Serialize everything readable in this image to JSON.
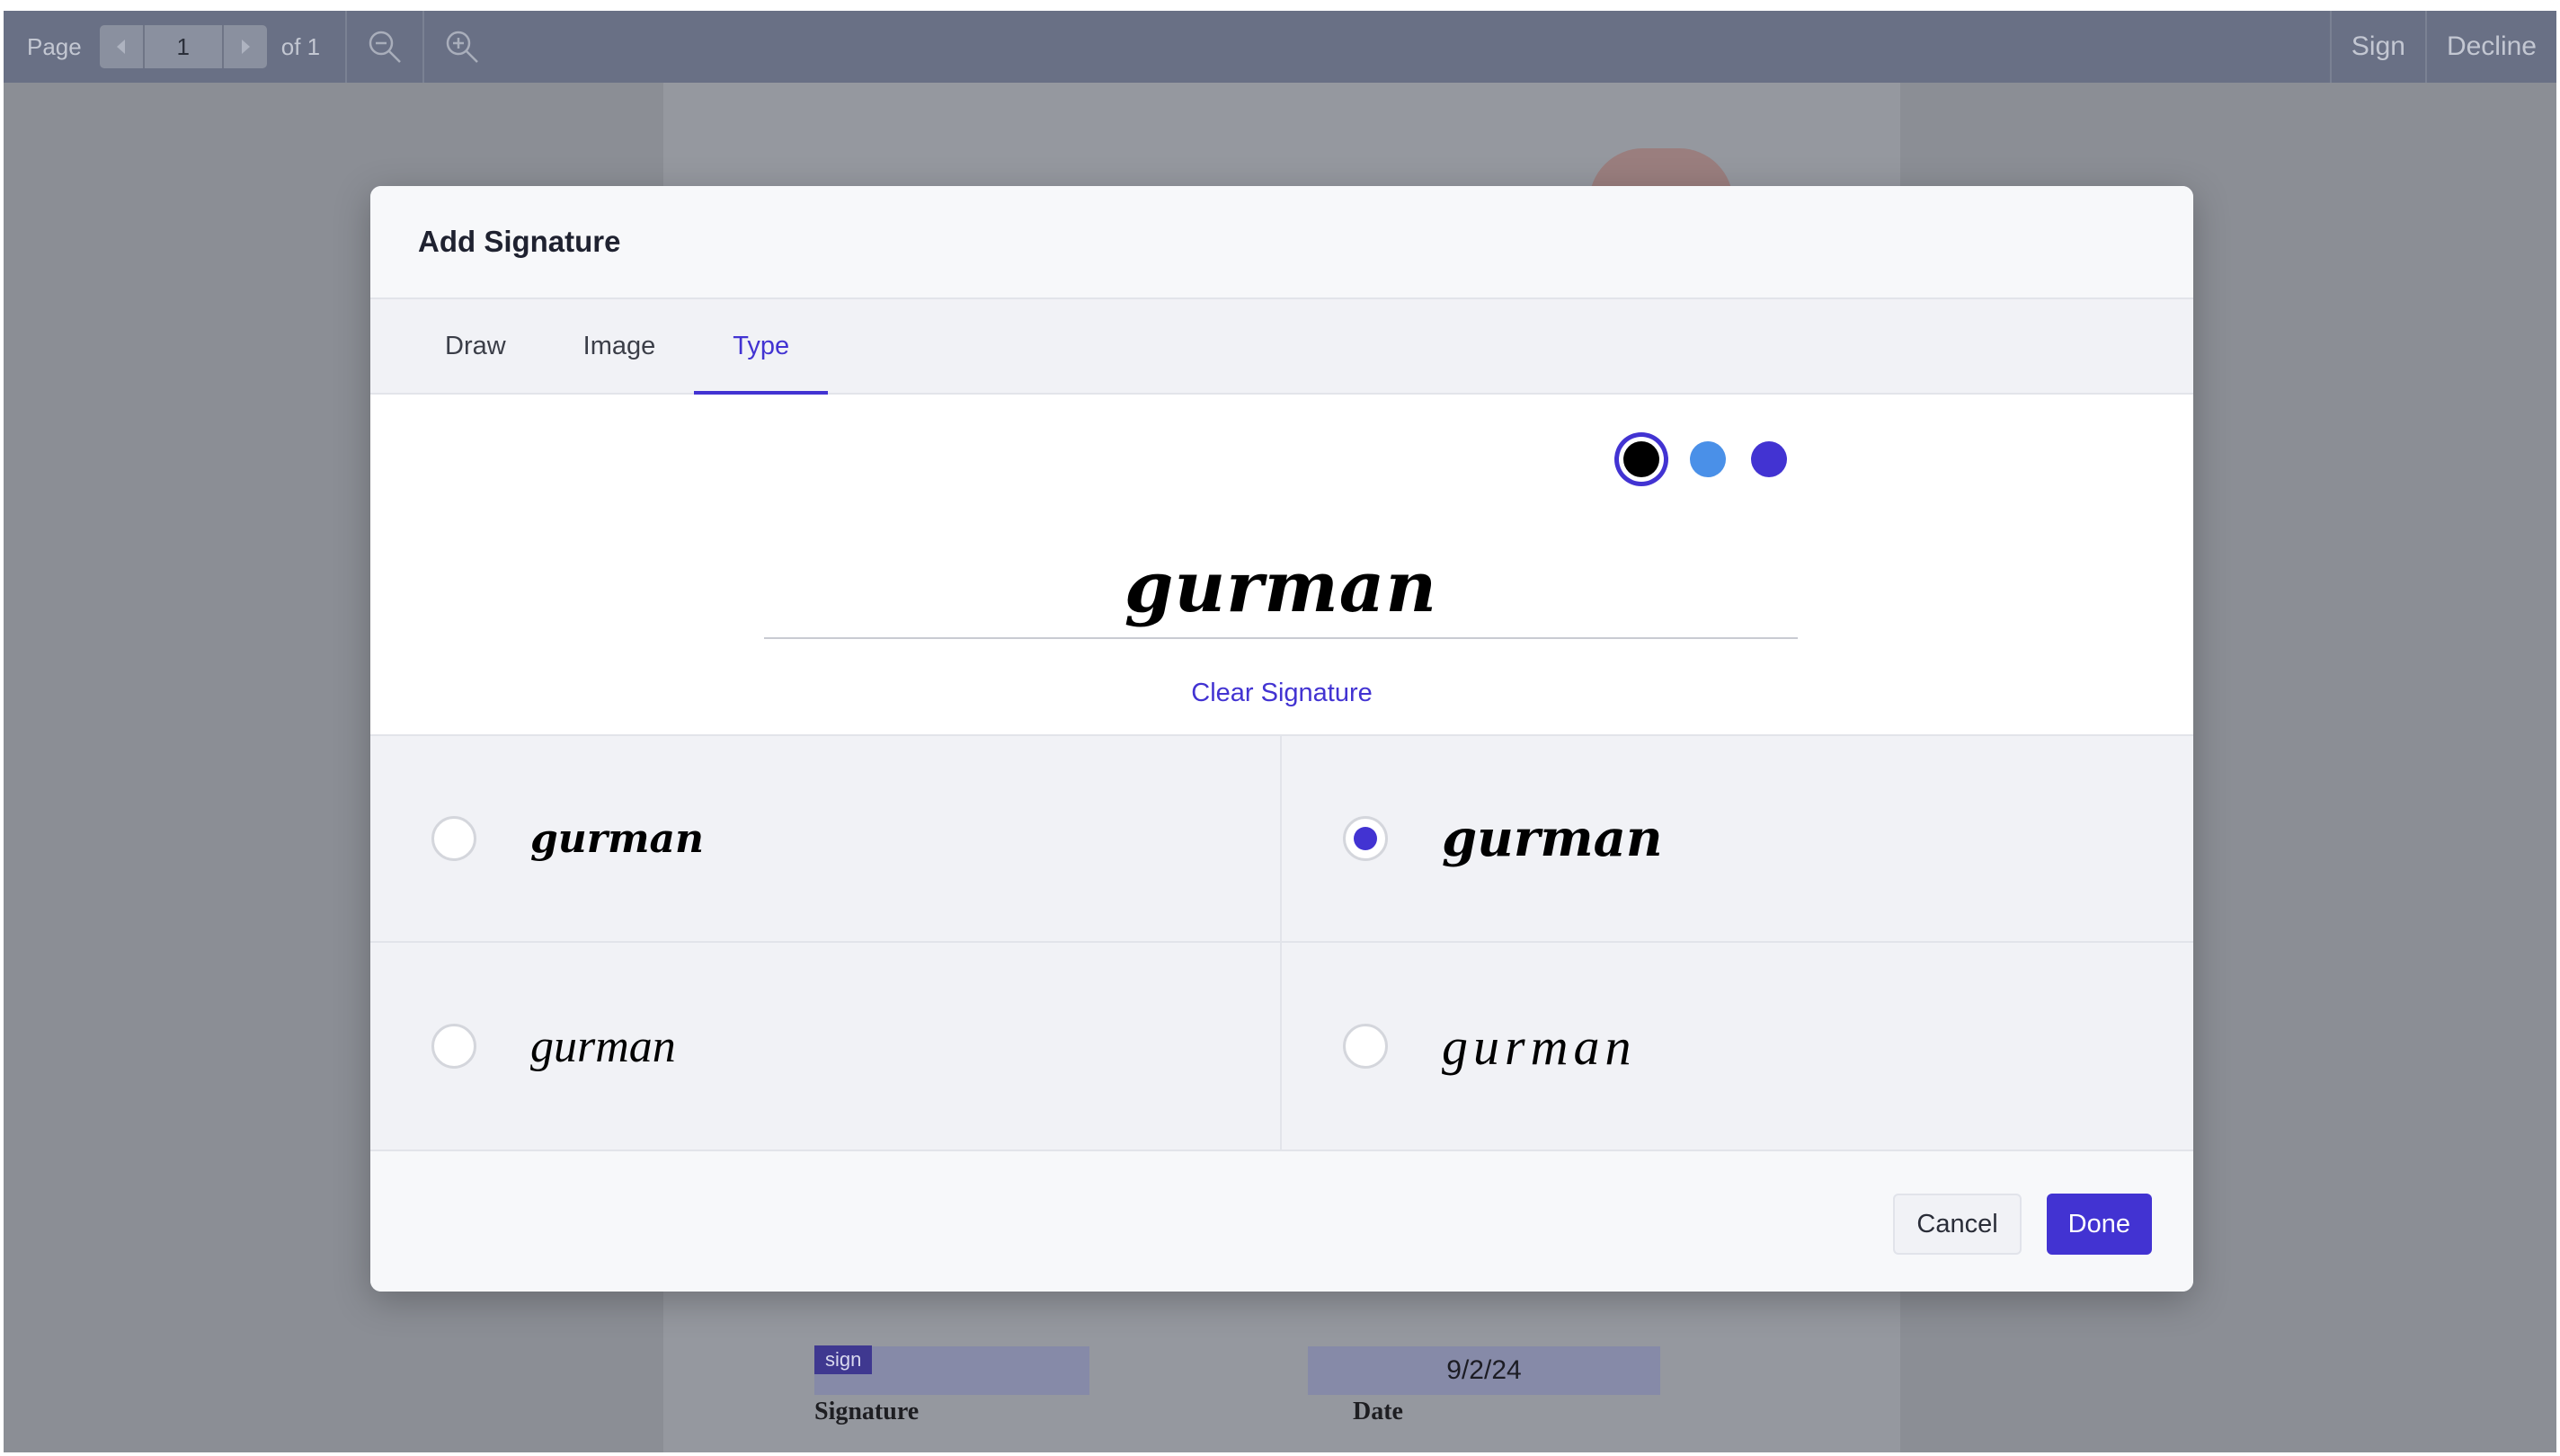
{
  "toolbar": {
    "page_label": "Page",
    "page_value": "1",
    "page_total": "of 1",
    "sign_label": "Sign",
    "decline_label": "Decline"
  },
  "document": {
    "sign_tag": "sign",
    "date_value": "9/2/24",
    "signature_label": "Signature",
    "date_label": "Date"
  },
  "modal": {
    "title": "Add Signature",
    "tabs": [
      {
        "label": "Draw",
        "active": false
      },
      {
        "label": "Image",
        "active": false
      },
      {
        "label": "Type",
        "active": true
      }
    ],
    "colors": [
      "#000000",
      "#4a90e8",
      "#4233d2"
    ],
    "selected_color": "#000000",
    "signature_text": "gurman",
    "clear_label": "Clear Signature",
    "font_options": [
      {
        "text": "gurman",
        "selected": false
      },
      {
        "text": "gurman",
        "selected": true
      },
      {
        "text": "gurman",
        "selected": false
      },
      {
        "text": "gurman",
        "selected": false
      }
    ],
    "cancel_label": "Cancel",
    "done_label": "Done"
  },
  "theme": {
    "accent": "#4233d2",
    "toolbar_bg": "#697085"
  }
}
